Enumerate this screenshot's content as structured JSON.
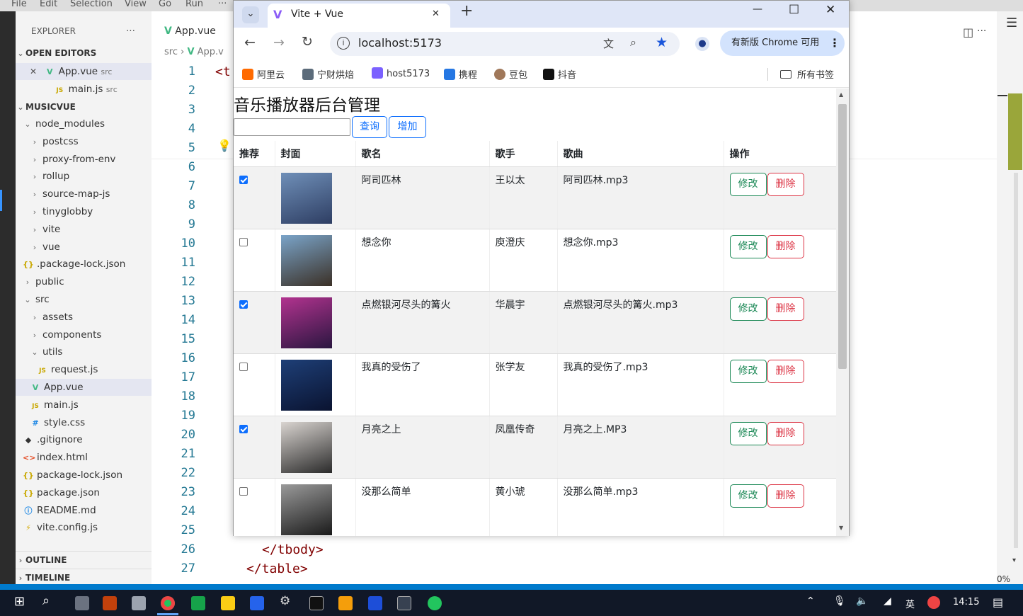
{
  "vscode": {
    "menu": [
      "File",
      "Edit",
      "Selection",
      "View",
      "Go",
      "Run",
      "···"
    ],
    "explorer_title": "EXPLORER",
    "explorer_more": "···",
    "open_editors_title": "OPEN EDITORS",
    "open_editors": [
      {
        "close": "✕",
        "name": "App.vue",
        "dir": "src"
      },
      {
        "name": "main.js",
        "dir": "src"
      }
    ],
    "project_title": "MUSICVUE",
    "tree": [
      {
        "label": "node_modules",
        "chev": "⌄"
      },
      {
        "label": "postcss",
        "chev": "›"
      },
      {
        "label": "proxy-from-env",
        "chev": "›"
      },
      {
        "label": "rollup",
        "chev": "›"
      },
      {
        "label": "source-map-js",
        "chev": "›"
      },
      {
        "label": "tinyglobby",
        "chev": "›"
      },
      {
        "label": "vite",
        "chev": "›"
      },
      {
        "label": "vue",
        "chev": "›"
      },
      {
        "label": ".package-lock.json",
        "icon": "{}"
      },
      {
        "label": "public",
        "chev": "›"
      },
      {
        "label": "src",
        "chev": "⌄"
      },
      {
        "label": "assets",
        "chev": "›"
      },
      {
        "label": "components",
        "chev": "›"
      },
      {
        "label": "utils",
        "chev": "⌄"
      },
      {
        "label": "request.js",
        "icon": "JS"
      },
      {
        "label": "App.vue",
        "icon": "V"
      },
      {
        "label": "main.js",
        "icon": "JS"
      },
      {
        "label": "style.css",
        "icon": "#"
      },
      {
        "label": ".gitignore",
        "icon": "◆"
      },
      {
        "label": "index.html",
        "icon": "<>"
      },
      {
        "label": "package-lock.json",
        "icon": "{}"
      },
      {
        "label": "package.json",
        "icon": "{}"
      },
      {
        "label": "README.md",
        "icon": "ⓘ"
      },
      {
        "label": "vite.config.js",
        "icon": "⚡"
      }
    ],
    "outline_title": "OUTLINE",
    "timeline_title": "TIMELINE",
    "editor_tab": "App.vue",
    "breadcrumb_dir": "src",
    "breadcrumb_file": "App.v",
    "line_numbers": [
      "1",
      "2",
      "3",
      "4",
      "5",
      "6",
      "7",
      "8",
      "9",
      "10",
      "11",
      "12",
      "13",
      "14",
      "15",
      "16",
      "17",
      "18",
      "19",
      "20",
      "21",
      "22",
      "23",
      "24",
      "25",
      "26",
      "27"
    ],
    "code_line1": "<t",
    "code_line26": "</tbody>",
    "code_line27": "</table>",
    "status_zoom": "0%"
  },
  "browser": {
    "tab_title": "Vite + Vue",
    "tab_close": "✕",
    "new_tab": "+",
    "window_controls": [
      "—",
      "☐",
      "✕"
    ],
    "url": "localhost:5173",
    "update_label": "有新版 Chrome 可用",
    "bookmarks": [
      {
        "label": "阿里云",
        "color": "#ff6a00"
      },
      {
        "label": "宁财烘焙",
        "color": "#5b6b7a"
      },
      {
        "label": "host5173",
        "color": "#7b61ff"
      },
      {
        "label": "携程",
        "color": "#2577e3"
      },
      {
        "label": "豆包",
        "color": "#a0785a"
      },
      {
        "label": "抖音",
        "color": "#111111"
      }
    ],
    "all_bookmarks": "所有书签"
  },
  "page": {
    "title": "音乐播放器后台管理",
    "search_value": "",
    "query_label": "查询",
    "add_label": "增加",
    "columns": [
      "推荐",
      "封面",
      "歌名",
      "歌手",
      "歌曲",
      "操作"
    ],
    "edit_label": "修改",
    "delete_label": "删除",
    "rows": [
      {
        "recommended": true,
        "name": "阿司匹林",
        "singer": "王以太",
        "file": "阿司匹林.mp3",
        "cover_colors": [
          "#6f8fb8",
          "#2e3e63"
        ]
      },
      {
        "recommended": false,
        "name": "想念你",
        "singer": "庾澄庆",
        "file": "想念你.mp3",
        "cover_colors": [
          "#7aa4c9",
          "#3b3026"
        ]
      },
      {
        "recommended": true,
        "name": "点燃银河尽头的篝火",
        "singer": "华晨宇",
        "file": "点燃银河尽头的篝火.mp3",
        "cover_colors": [
          "#b2338f",
          "#2a1640"
        ]
      },
      {
        "recommended": false,
        "name": "我真的受伤了",
        "singer": "张学友",
        "file": "我真的受伤了.mp3",
        "cover_colors": [
          "#1e3f77",
          "#0a1330"
        ]
      },
      {
        "recommended": true,
        "name": "月亮之上",
        "singer": "凤凰传奇",
        "file": "月亮之上.MP3",
        "cover_colors": [
          "#d9d4d0",
          "#2b2b2b"
        ]
      },
      {
        "recommended": false,
        "name": "没那么简单",
        "singer": "黄小琥",
        "file": "没那么简单.mp3",
        "cover_colors": [
          "#9a9a9a",
          "#1a1a1a"
        ]
      }
    ]
  },
  "taskbar": {
    "ime": "英",
    "time": "14:15"
  }
}
